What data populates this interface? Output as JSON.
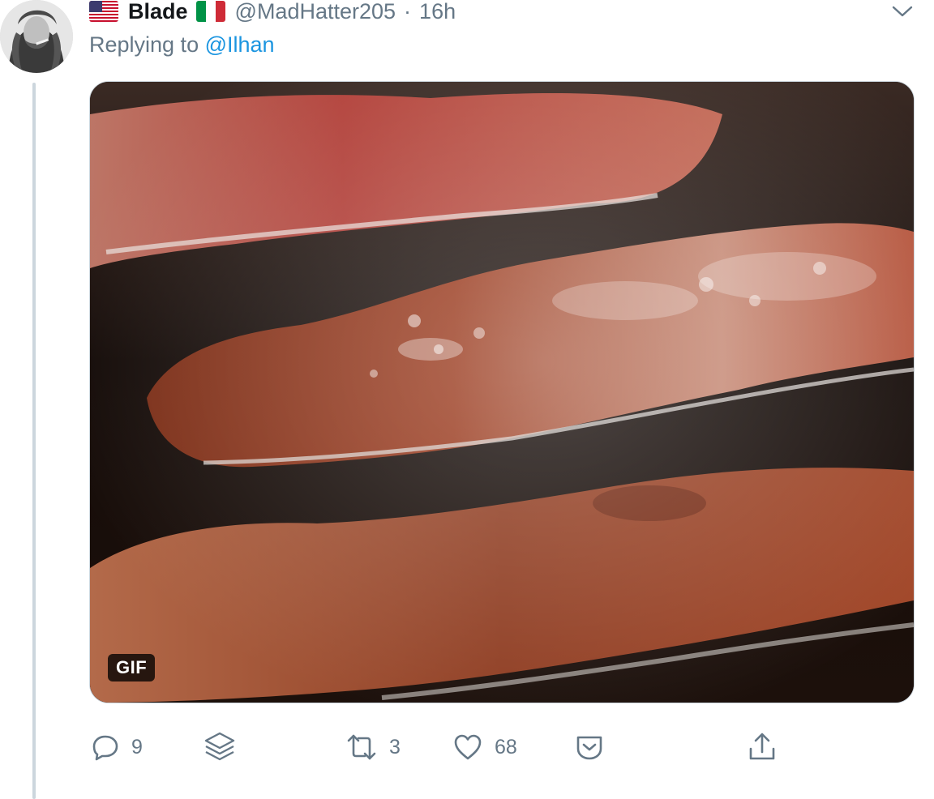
{
  "tweet": {
    "display_name": "Blade",
    "handle": "@MadHatter205",
    "separator": "·",
    "time": "16h",
    "replying_prefix": "Replying to",
    "replying_to": "@Ilhan",
    "media_badge": "GIF"
  },
  "actions": {
    "reply_count": "9",
    "retweet_count": "3",
    "like_count": "68"
  },
  "icons": {
    "flag_1": "us-flag-icon",
    "flag_2": "italy-flag-icon",
    "caret": "chevron-down-icon",
    "reply": "reply-icon",
    "layers": "layers-icon",
    "retweet": "retweet-icon",
    "like": "heart-icon",
    "save": "save-icon",
    "share": "share-icon"
  },
  "colors": {
    "accent": "#1b95e0",
    "secondary_text": "#657786",
    "thread_line": "#ccd6dd"
  }
}
